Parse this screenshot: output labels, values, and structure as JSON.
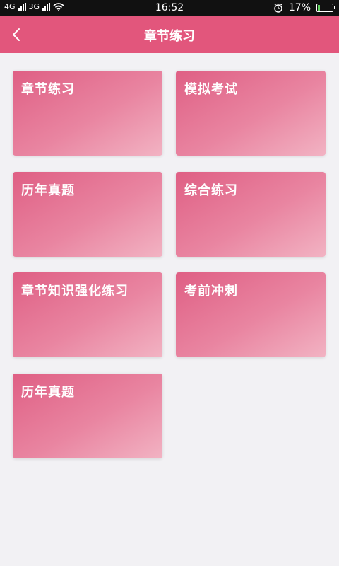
{
  "status_bar": {
    "left_labels": [
      "4G",
      "3G"
    ],
    "time": "16:52",
    "battery_percent": "17%",
    "battery_level": 0.17,
    "icons": [
      "signal-icon",
      "wifi-icon",
      "alarm-icon",
      "battery-icon"
    ]
  },
  "header": {
    "title": "章节练习",
    "back_icon": "chevron-left-icon"
  },
  "tiles": [
    {
      "label": "章节练习"
    },
    {
      "label": "模拟考试"
    },
    {
      "label": "历年真题"
    },
    {
      "label": "综合练习"
    },
    {
      "label": "章节知识强化练习"
    },
    {
      "label": "考前冲刺"
    },
    {
      "label": "历年真题"
    }
  ],
  "colors": {
    "header": "#e2567c",
    "tile_start": "#df5f84",
    "tile_end": "#f2b3c3",
    "background": "#f2f1f4"
  }
}
